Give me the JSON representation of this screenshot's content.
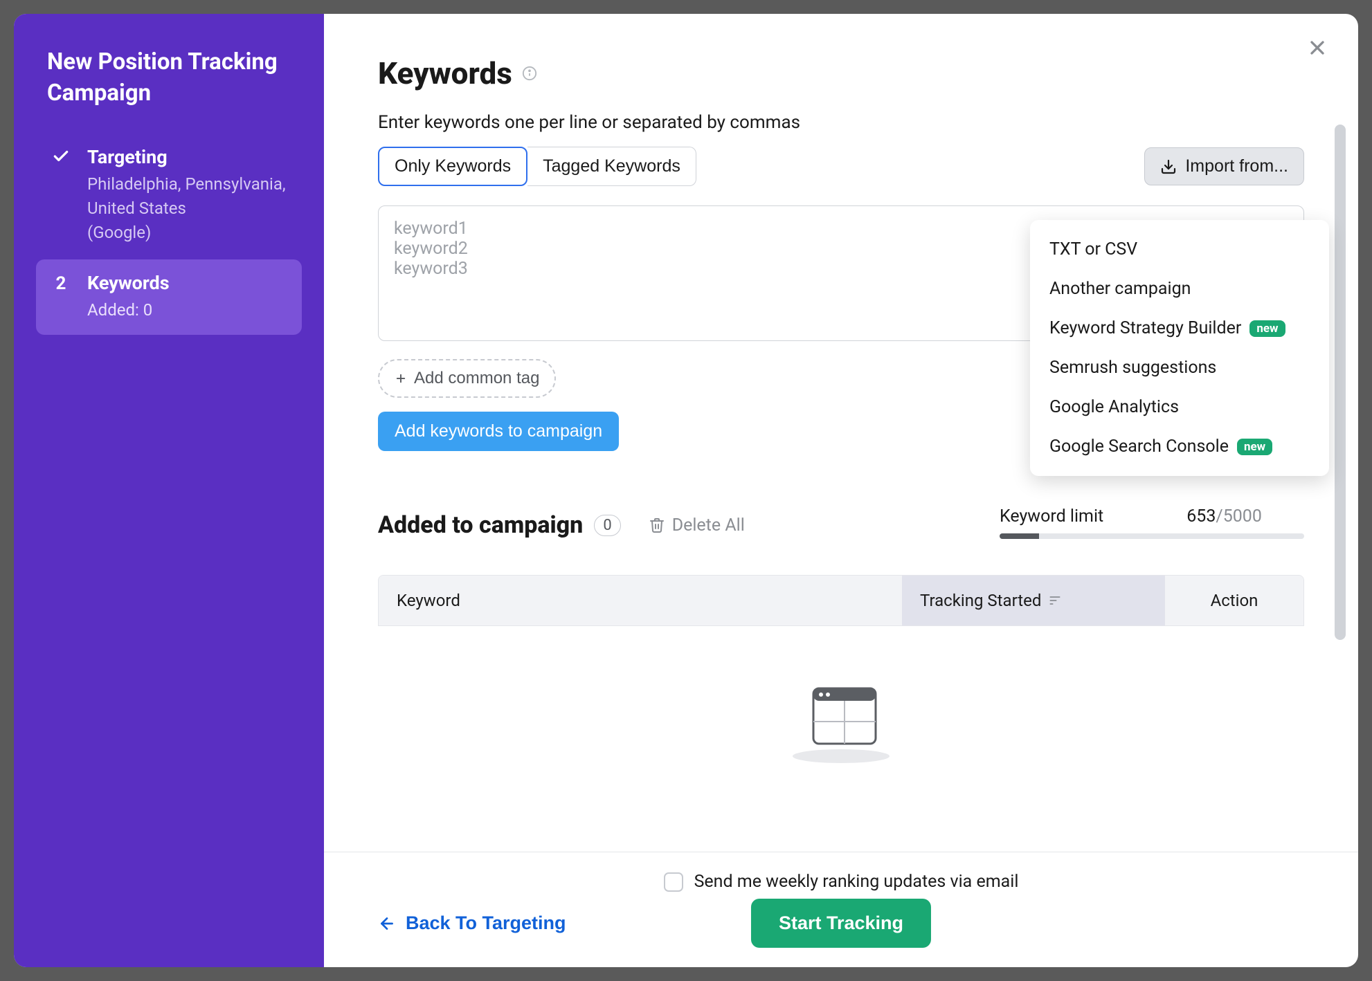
{
  "sidebar": {
    "title": "New Position Tracking Campaign",
    "steps": [
      {
        "label": "Targeting",
        "sub_location": "Philadelphia, Pennsylvania, United States",
        "sub_engine": "(Google)"
      },
      {
        "number": "2",
        "label": "Keywords",
        "sub_added": "Added: 0"
      }
    ]
  },
  "main": {
    "title": "Keywords",
    "subtitle": "Enter keywords one per line or separated by commas",
    "tabs": {
      "only": "Only Keywords",
      "tagged": "Tagged Keywords"
    },
    "import_label": "Import from...",
    "textarea_placeholder": "keyword1\nkeyword2\nkeyword3",
    "add_tag_label": "Add common tag",
    "add_keywords_label": "Add keywords to campaign",
    "dropdown": {
      "txt_csv": "TXT or CSV",
      "another_campaign": "Another campaign",
      "strategy_builder": "Keyword Strategy Builder",
      "semrush": "Semrush suggestions",
      "ga": "Google Analytics",
      "gsc": "Google Search Console",
      "new_badge": "new"
    },
    "added_section": {
      "title": "Added to campaign",
      "count": "0",
      "delete_all": "Delete All"
    },
    "limit": {
      "label": "Keyword limit",
      "used": "653",
      "total": "/5000"
    },
    "table": {
      "col_keyword": "Keyword",
      "col_tracking": "Tracking Started",
      "col_action": "Action"
    }
  },
  "footer": {
    "email_label": "Send me weekly ranking updates via email",
    "back_label": "Back To Targeting",
    "start_label": "Start Tracking"
  }
}
